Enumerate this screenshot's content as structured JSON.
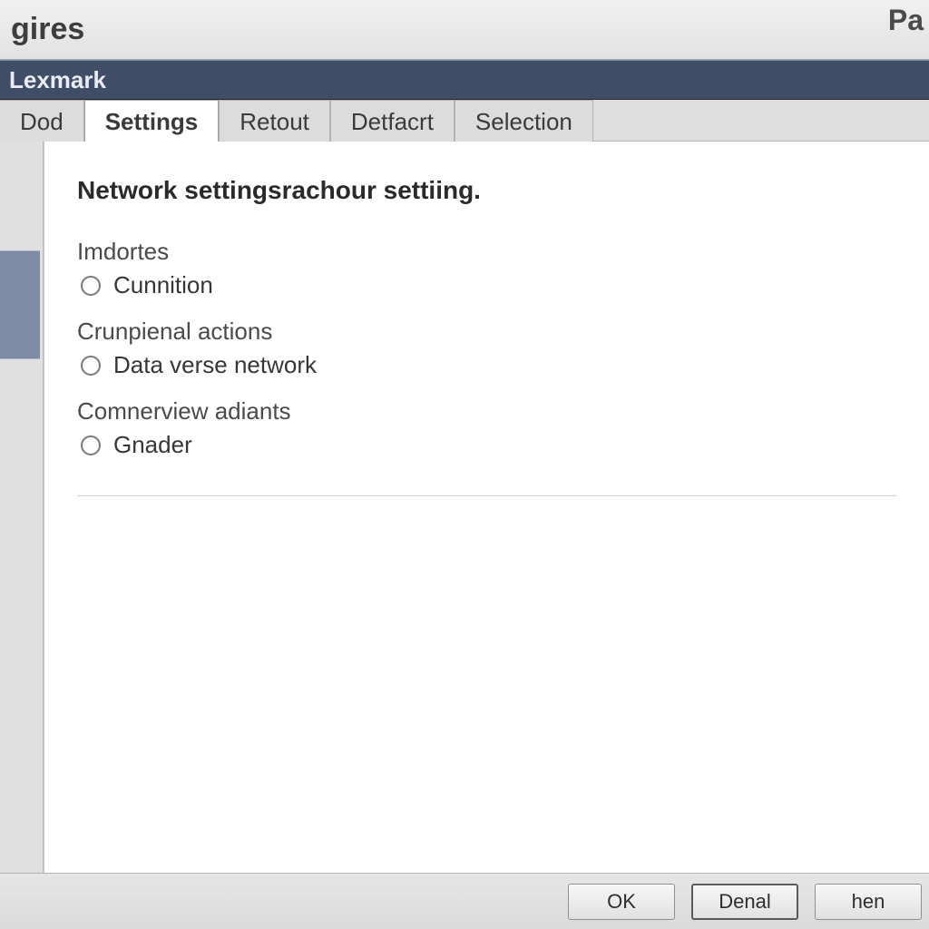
{
  "window": {
    "title": "gires",
    "corner_label": "Pa"
  },
  "subheader": {
    "label": "Lexmark"
  },
  "tabs": [
    {
      "label": "Dod",
      "active": false
    },
    {
      "label": "Settings",
      "active": true
    },
    {
      "label": "Retout",
      "active": false
    },
    {
      "label": "Detfacrt",
      "active": false
    },
    {
      "label": "Selection",
      "active": false
    }
  ],
  "content": {
    "section_title": "Network settingsrachour settiing.",
    "groups": [
      {
        "label": "Imdortes",
        "option": "Cunnition"
      },
      {
        "label": "Crunpienal actions",
        "option": "Data verse network"
      },
      {
        "label": "Comnerview adiants",
        "option": "Gnader"
      }
    ]
  },
  "footer": {
    "ok": "OK",
    "cancel": "Denal",
    "help": "hen"
  }
}
